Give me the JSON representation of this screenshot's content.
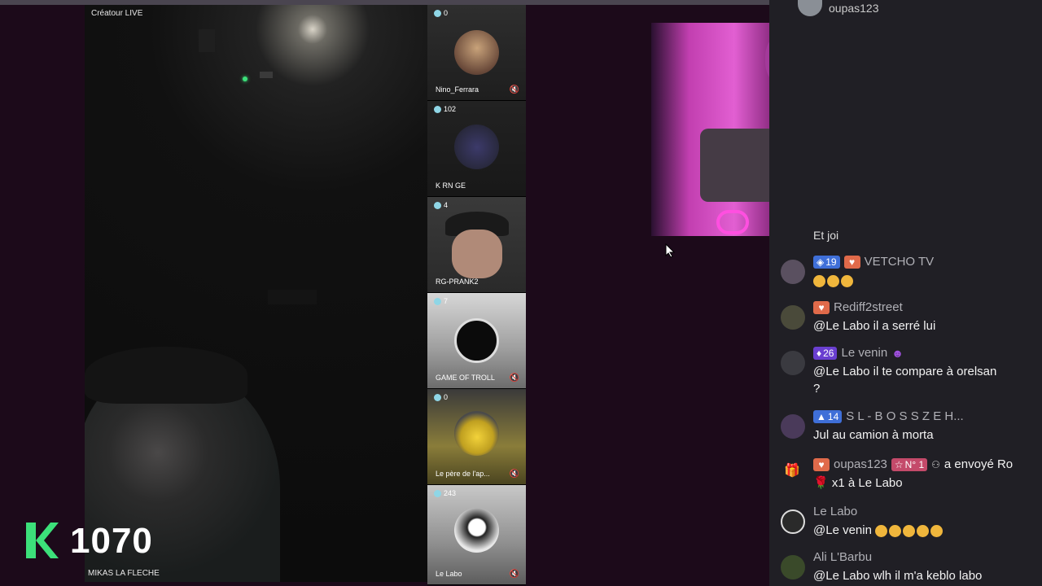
{
  "main": {
    "creator_label": "Créatour LIVE",
    "host_name": "MIKAS LA FLECHE",
    "score": "1070",
    "score_logo": "K"
  },
  "guests": [
    {
      "viewers": "0",
      "name": "Nino_Ferrara"
    },
    {
      "viewers": "102",
      "name": "K RN GE"
    },
    {
      "viewers": "4",
      "name": "RG-PRANK2"
    },
    {
      "viewers": "7",
      "name": "GAME OF TROLL"
    },
    {
      "viewers": "0",
      "name": "Le père de l'ap..."
    },
    {
      "viewers": "243",
      "name": "Le Labo"
    }
  ],
  "chat": {
    "top_user": "oupas123",
    "partial_text": "Et joi",
    "messages": [
      {
        "badge": "19",
        "user": "VETCHO TV",
        "text": ""
      },
      {
        "badge": "",
        "user": "Rediff2street",
        "text": "@Le Labo il a serré lui"
      },
      {
        "badge": "26",
        "user": "Le venin",
        "text": "@Le Labo il te compare à orelsan"
      },
      {
        "badge": "14",
        "user": "S L - B O S S Z E H...",
        "text": "Jul au camion à morta"
      },
      {
        "badge": "N° 1",
        "user": "oupas123",
        "action": "a envoyé Ro",
        "text": "x1 à Le Labo"
      },
      {
        "badge": "",
        "user": "Le Labo",
        "text": "@Le venin"
      },
      {
        "badge": "",
        "user": "Ali L'Barbu",
        "text": "@Le Labo wlh il m'a keblo labo"
      }
    ],
    "continuation": "?"
  },
  "colors": {
    "accent": "#3ce07a",
    "chat_bg": "#201f25",
    "stage_bg": "#1c0a1a"
  }
}
